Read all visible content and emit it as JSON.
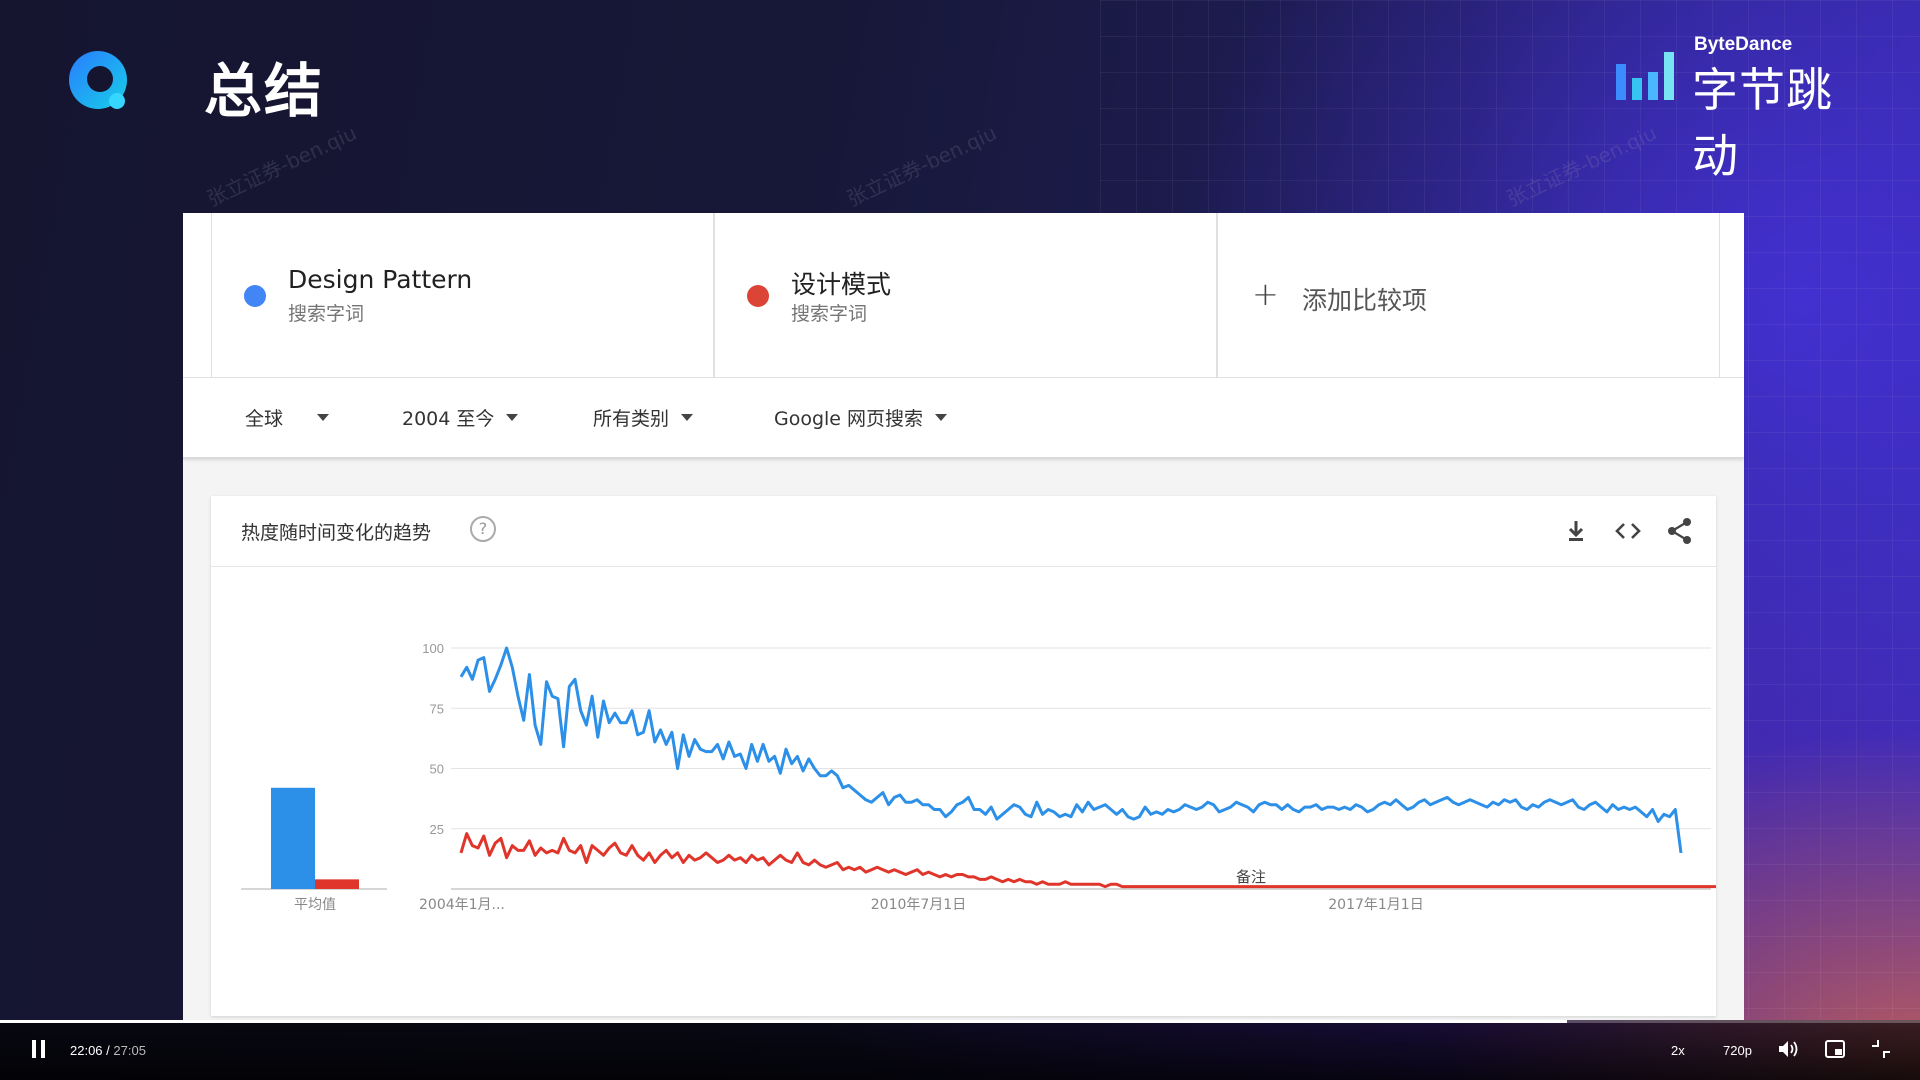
{
  "slide": {
    "title": "总结"
  },
  "brand": {
    "small": "ByteDance",
    "big": "字节跳动"
  },
  "watermark": "张立证券-ben.qiu",
  "terms": [
    {
      "name": "Design Pattern",
      "sub": "搜索字词",
      "color": "#4285f4"
    },
    {
      "name": "设计模式",
      "sub": "搜索字词",
      "color": "#db4437"
    }
  ],
  "add_term": {
    "label": "添加比较项"
  },
  "filters": [
    {
      "label": "全球"
    },
    {
      "label": "2004 至今"
    },
    {
      "label": "所有类别"
    },
    {
      "label": "Google 网页搜索"
    }
  ],
  "card": {
    "title": "热度随时间变化的趋势",
    "help": "?"
  },
  "chart_data": {
    "type": "line",
    "x_start": "2004年1月...",
    "x_tick_labels": [
      "2004年1月...",
      "2010年7月1日",
      "2017年1月1日"
    ],
    "y_ticks": [
      25,
      50,
      75,
      100
    ],
    "ylim": [
      0,
      100
    ],
    "annotation": "备注",
    "average_label": "平均值",
    "averages": [
      {
        "name": "Design Pattern",
        "value": 42,
        "color": "#2c8fe8"
      },
      {
        "name": "设计模式",
        "value": 4,
        "color": "#e0352b"
      }
    ],
    "series": [
      {
        "name": "Design Pattern",
        "color": "#2c8fe8",
        "values": [
          88,
          92,
          87,
          95,
          96,
          82,
          87,
          93,
          100,
          92,
          80,
          70,
          89,
          68,
          60,
          86,
          80,
          79,
          59,
          84,
          87,
          74,
          68,
          80,
          63,
          78,
          69,
          73,
          69,
          69,
          74,
          64,
          65,
          74,
          61,
          66,
          60,
          65,
          50,
          64,
          55,
          62,
          58,
          57,
          57,
          60,
          54,
          61,
          55,
          56,
          50,
          60,
          53,
          60,
          53,
          55,
          48,
          58,
          52,
          55,
          49,
          54,
          50,
          47,
          47,
          49,
          47,
          42,
          43,
          41,
          39,
          37,
          36,
          38,
          40,
          35,
          38,
          39,
          36,
          36,
          37,
          35,
          35,
          33,
          33,
          30,
          32,
          35,
          36,
          38,
          33,
          33,
          31,
          34,
          29,
          31,
          33,
          35,
          34,
          31,
          30,
          36,
          31,
          33,
          32,
          30,
          31,
          30,
          35,
          32,
          36,
          33,
          34,
          35,
          33,
          31,
          33,
          30,
          29,
          30,
          34,
          31,
          32,
          31,
          33,
          32,
          33,
          35,
          34,
          33,
          34,
          36,
          35,
          32,
          33,
          34,
          36,
          35,
          34,
          32,
          35,
          36,
          35,
          35,
          33,
          35,
          33,
          32,
          34,
          34,
          35,
          33,
          34,
          34,
          33,
          34,
          33,
          35,
          34,
          32,
          33,
          35,
          36,
          35,
          37,
          35,
          33,
          34,
          36,
          37,
          35,
          36,
          37,
          38,
          36,
          35,
          36,
          37,
          36,
          35,
          34,
          36,
          35,
          37,
          36,
          37,
          34,
          33,
          35,
          34,
          36,
          37,
          36,
          35,
          36,
          37,
          34,
          33,
          35,
          36,
          34,
          32,
          35,
          33,
          34,
          33,
          34,
          32,
          30,
          33,
          28,
          31,
          30,
          33,
          15
        ]
      },
      {
        "name": "设计模式",
        "color": "#e0352b",
        "values": [
          15,
          23,
          18,
          17,
          22,
          14,
          19,
          21,
          13,
          18,
          16,
          16,
          20,
          14,
          17,
          15,
          16,
          15,
          21,
          16,
          15,
          18,
          11,
          18,
          16,
          14,
          17,
          19,
          15,
          14,
          18,
          14,
          12,
          15,
          11,
          14,
          16,
          13,
          15,
          11,
          14,
          12,
          13,
          15,
          13,
          11,
          12,
          14,
          12,
          13,
          11,
          14,
          12,
          13,
          10,
          12,
          14,
          12,
          11,
          15,
          11,
          10,
          12,
          10,
          9,
          10,
          11,
          8,
          9,
          8,
          9,
          7,
          8,
          9,
          8,
          7,
          8,
          7,
          6,
          7,
          8,
          6,
          7,
          6,
          5,
          6,
          5,
          6,
          6,
          5,
          5,
          4,
          4,
          5,
          4,
          3,
          4,
          3,
          4,
          3,
          3,
          2,
          3,
          2,
          2,
          2,
          3,
          2,
          2,
          2,
          2,
          2,
          2,
          1,
          2,
          2,
          1,
          1,
          1,
          1,
          1,
          1,
          1,
          1,
          1,
          1,
          1,
          1,
          1,
          1,
          1,
          1,
          1,
          1,
          1,
          1,
          1,
          1,
          1,
          1,
          1,
          1,
          1,
          1,
          1,
          1,
          1,
          1,
          1,
          1,
          1,
          1,
          1,
          1,
          1,
          1,
          1,
          1,
          1,
          1,
          1,
          1,
          1,
          1,
          1,
          1,
          1,
          1,
          1,
          1,
          1,
          1,
          1,
          1,
          1,
          1,
          1,
          1,
          1,
          1,
          1,
          1,
          1,
          1,
          1,
          1,
          1,
          1,
          1,
          1,
          1,
          1,
          1,
          1,
          1,
          1,
          1,
          1,
          1,
          1,
          1,
          1,
          1,
          1,
          1,
          1,
          1,
          1,
          1,
          1,
          1,
          1,
          1,
          1,
          1,
          1,
          1,
          1,
          1,
          1,
          1,
          1
        ]
      }
    ]
  },
  "video": {
    "current": "22:06",
    "sep": " / ",
    "total": "27:05",
    "progress": 0.816,
    "speed": "2x",
    "quality": "720p"
  }
}
